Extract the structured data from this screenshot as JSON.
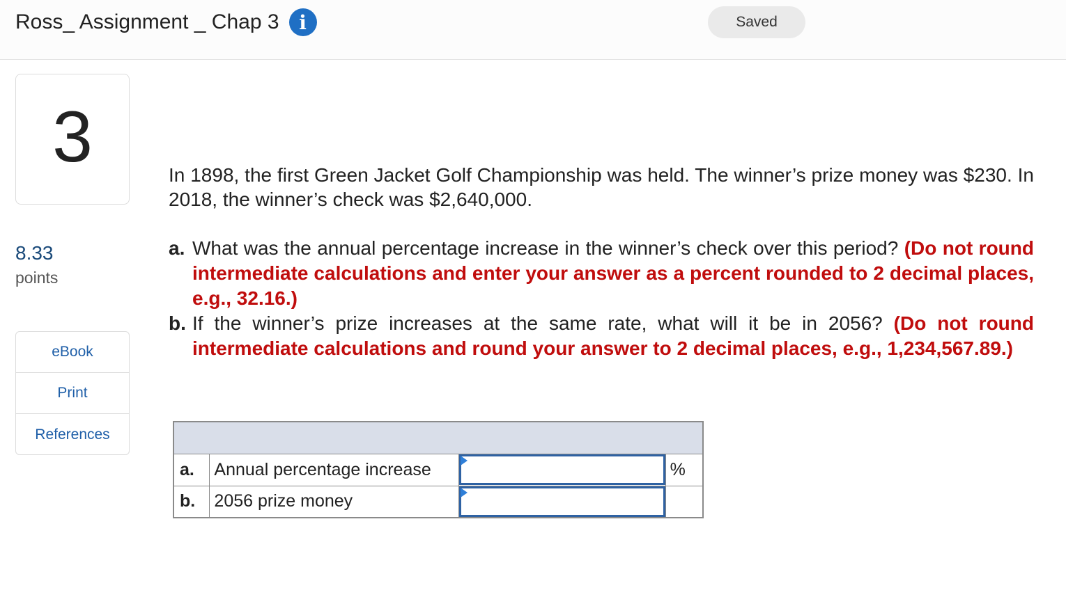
{
  "header": {
    "title": "Ross_ Assignment _ Chap 3",
    "info_icon": "info-icon",
    "status": "Saved"
  },
  "question": {
    "number": "3",
    "points_value": "8.33",
    "points_label": "points",
    "intro": "In 1898, the first Green Jacket Golf Championship was held. The winner’s prize money was $230. In 2018, the winner’s check was $2,640,000.",
    "parts": [
      {
        "label": "a.",
        "text": "What was the annual percentage increase in the winner’s check over this period? ",
        "instruction": "(Do not round intermediate calculations and enter your answer as a percent rounded to 2 decimal places, e.g., 32.16.)"
      },
      {
        "label": "b.",
        "text": "If the winner’s prize increases at the same rate, what will it be in 2056? ",
        "instruction": "(Do not round intermediate calculations and round your answer to 2 decimal places, e.g., 1,234,567.89.)"
      }
    ]
  },
  "tools": {
    "ebook": "eBook",
    "print": "Print",
    "references": "References"
  },
  "answer_table": {
    "rows": [
      {
        "letter": "a.",
        "description": "Annual percentage increase",
        "value": "",
        "unit": "%"
      },
      {
        "letter": "b.",
        "description": "2056 prize money",
        "value": "",
        "unit": ""
      }
    ]
  },
  "colors": {
    "instruction_red": "#c00d0d",
    "link_blue": "#1f5fa8",
    "input_border": "#2f62a3",
    "table_header": "#d9dee9"
  }
}
